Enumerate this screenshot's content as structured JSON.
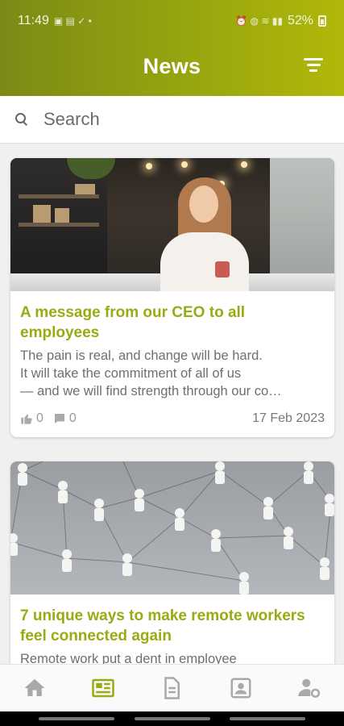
{
  "status_bar": {
    "time": "11:49",
    "battery": "52%"
  },
  "header": {
    "title": "News"
  },
  "search": {
    "placeholder": "Search"
  },
  "articles": [
    {
      "title": "A message from our CEO to all employees",
      "excerpt_lines": [
        "The pain is real, and change will be hard.",
        "It will take the commitment of all of us",
        "— and we will find strength through our co…"
      ],
      "likes": "0",
      "comments": "0",
      "date": "17 Feb 2023"
    },
    {
      "title": "7 unique ways to make remote workers feel connected again",
      "excerpt_lines": [
        "Remote work put a dent in employee"
      ]
    }
  ],
  "bottom_nav": [
    {
      "icon": "home-icon",
      "active": false
    },
    {
      "icon": "news-icon",
      "active": true
    },
    {
      "icon": "document-icon",
      "active": false
    },
    {
      "icon": "profile-card-icon",
      "active": false
    },
    {
      "icon": "user-settings-icon",
      "active": false
    }
  ],
  "colors": {
    "accent": "#9aaa12",
    "header_start": "#7c8a16",
    "header_end": "#b1b80a",
    "inactive_icon": "#a9a9a9"
  }
}
